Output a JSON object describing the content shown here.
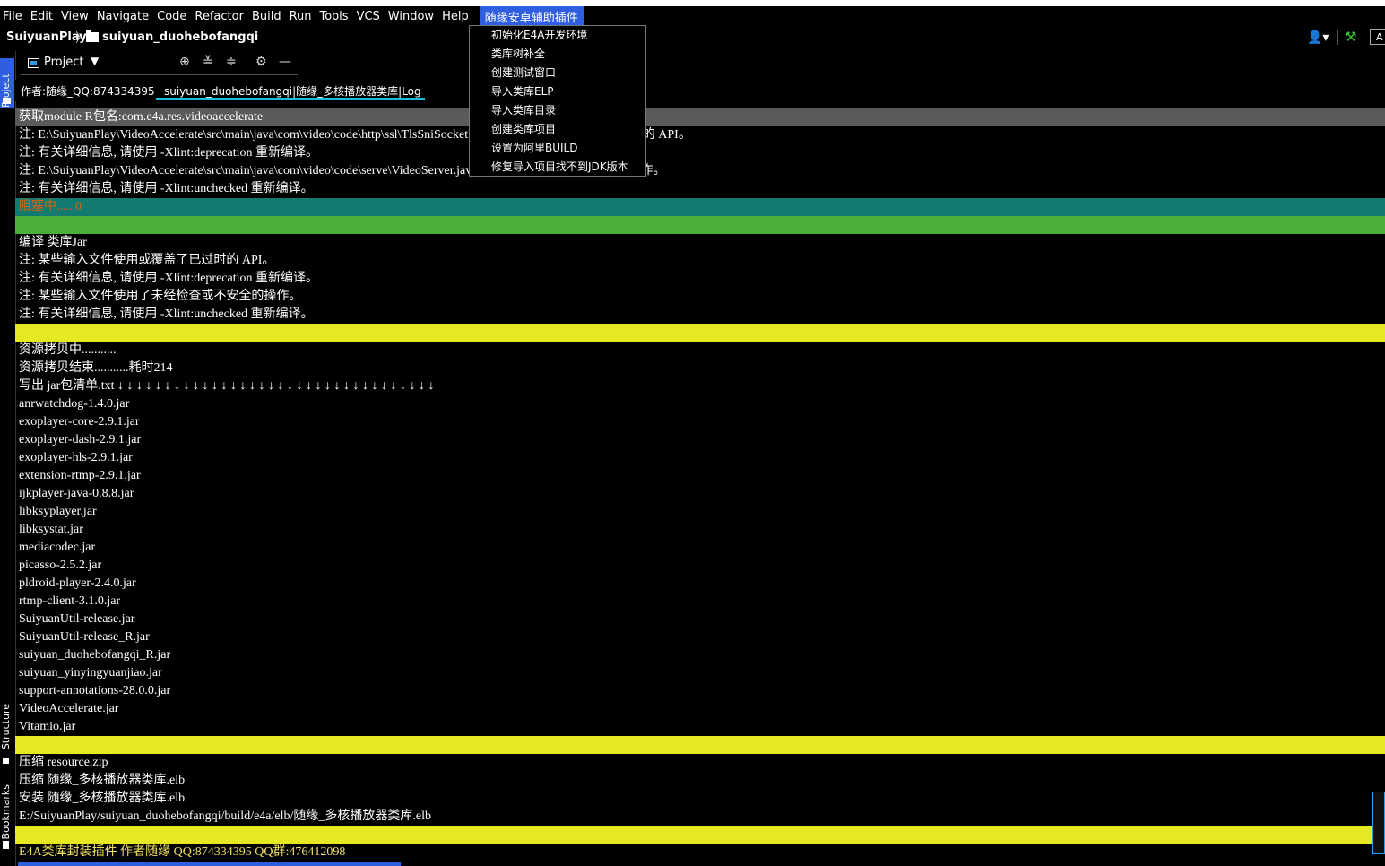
{
  "menubar": {
    "items": [
      "File",
      "Edit",
      "View",
      "Navigate",
      "Code",
      "Refactor",
      "Build",
      "Run",
      "Tools",
      "VCS",
      "Window",
      "Help"
    ],
    "plugin_menu": "随缘安卓辅助插件"
  },
  "plugin_popup": {
    "items": [
      "初始化E4A开发环境",
      "类库树补全",
      "创建测试窗口",
      "导入类库ELP",
      "导入类库目录",
      "创建类库项目",
      "设置为阿里BUILD",
      "修复导入项目找不到JDK版本"
    ]
  },
  "navbar": {
    "project": "SuiyuanPlay",
    "separator": "〉",
    "module": "suiyuan_duohebofangqi",
    "button_label": "A"
  },
  "sidebar": {
    "project_tab": "Project",
    "structure_tab": "Structure",
    "bookmarks_tab": "Bookmarks"
  },
  "tool_window": {
    "title": "Project",
    "caret": "▼"
  },
  "tabs": {
    "author": "作者:随缘_QQ:874334395",
    "log": "suiyuan_duohebofangqi|随缘_多核播放器类库|Log"
  },
  "console": {
    "lines": [
      {
        "text": "获取module R包名:com.e4a.res.videoaccelerate",
        "style": "gray"
      },
      {
        "text": "注: E:\\SuiyuanPlay\\VideoAccelerate\\src\\main\\java\\com\\video\\code\\http\\ssl\\TlsSniSocketFactory.java使用或覆盖了已过时的 API。",
        "style": ""
      },
      {
        "text": "注: 有关详细信息, 请使用 -Xlint:deprecation 重新编译。",
        "style": ""
      },
      {
        "text": "注: E:\\SuiyuanPlay\\VideoAccelerate\\src\\main\\java\\com\\video\\code\\serve\\VideoServer.java使用了未经检查或不安全的操作。",
        "style": ""
      },
      {
        "text": "注: 有关详细信息, 请使用 -Xlint:unchecked 重新编译。",
        "style": ""
      },
      {
        "text": "阻塞中..... 0",
        "style": "teal"
      },
      {
        "text": "",
        "style": "green"
      },
      {
        "text": "编译 类库Jar",
        "style": ""
      },
      {
        "text": "注: 某些输入文件使用或覆盖了已过时的 API。",
        "style": ""
      },
      {
        "text": "注: 有关详细信息, 请使用 -Xlint:deprecation 重新编译。",
        "style": ""
      },
      {
        "text": "注: 某些输入文件使用了未经检查或不安全的操作。",
        "style": ""
      },
      {
        "text": "注: 有关详细信息, 请使用 -Xlint:unchecked 重新编译。",
        "style": ""
      },
      {
        "text": "",
        "style": "yellow"
      },
      {
        "text": "资源拷贝中...........",
        "style": ""
      },
      {
        "text": "资源拷贝结束...........耗时214",
        "style": ""
      },
      {
        "text": "写出 jar包清单.txt ↓ ↓ ↓ ↓ ↓ ↓ ↓ ↓ ↓ ↓ ↓ ↓ ↓ ↓ ↓ ↓ ↓ ↓ ↓ ↓ ↓ ↓ ↓ ↓ ↓ ↓ ↓ ↓ ↓ ↓ ↓ ↓ ↓ ↓",
        "style": ""
      },
      {
        "text": "anrwatchdog-1.4.0.jar",
        "style": ""
      },
      {
        "text": "exoplayer-core-2.9.1.jar",
        "style": ""
      },
      {
        "text": "exoplayer-dash-2.9.1.jar",
        "style": ""
      },
      {
        "text": "exoplayer-hls-2.9.1.jar",
        "style": ""
      },
      {
        "text": "extension-rtmp-2.9.1.jar",
        "style": ""
      },
      {
        "text": "ijkplayer-java-0.8.8.jar",
        "style": ""
      },
      {
        "text": "libksyplayer.jar",
        "style": ""
      },
      {
        "text": "libksystat.jar",
        "style": ""
      },
      {
        "text": "mediacodec.jar",
        "style": ""
      },
      {
        "text": "picasso-2.5.2.jar",
        "style": ""
      },
      {
        "text": "pldroid-player-2.4.0.jar",
        "style": ""
      },
      {
        "text": "rtmp-client-3.1.0.jar",
        "style": ""
      },
      {
        "text": "SuiyuanUtil-release.jar",
        "style": ""
      },
      {
        "text": "SuiyuanUtil-release_R.jar",
        "style": ""
      },
      {
        "text": "suiyuan_duohebofangqi_R.jar",
        "style": ""
      },
      {
        "text": "suiyuan_yinyingyuanjiao.jar",
        "style": ""
      },
      {
        "text": "support-annotations-28.0.0.jar",
        "style": ""
      },
      {
        "text": "VideoAccelerate.jar",
        "style": ""
      },
      {
        "text": "Vitamio.jar",
        "style": ""
      },
      {
        "text": "",
        "style": "yellow"
      },
      {
        "text": "压缩 resource.zip",
        "style": ""
      },
      {
        "text": "压缩 随缘_多核播放器类库.elb",
        "style": ""
      },
      {
        "text": "安装 随缘_多核播放器类库.elb",
        "style": ""
      },
      {
        "text": "E:/SuiyuanPlay/suiyuan_duohebofangqi/build/e4a/elb/随缘_多核播放器类库.elb",
        "style": ""
      },
      {
        "text": "",
        "style": "yellow"
      },
      {
        "text": "E4A类库封装插件 作者随缘 QQ:874334395 QQ群:476412098",
        "style": "footer"
      }
    ]
  },
  "colors": {
    "accent": "#2f5fe0",
    "teal": "#127a6e",
    "green": "#4caf3a",
    "yellow": "#e5e823",
    "blocked_text": "#e06010",
    "tab_underline": "#1fbcd6"
  },
  "icons": [
    "folder-icon",
    "user-icon",
    "hammer-icon",
    "locate-icon",
    "expand-all-icon",
    "collapse-all-icon",
    "gear-icon",
    "minimize-icon"
  ]
}
